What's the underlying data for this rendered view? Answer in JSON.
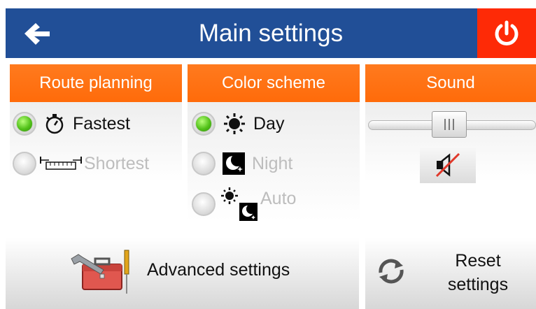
{
  "header": {
    "title": "Main settings"
  },
  "columns": {
    "route": {
      "title": "Route planning",
      "options": [
        {
          "label": "Fastest",
          "selected": true,
          "icon": "stopwatch-icon"
        },
        {
          "label": "Shortest",
          "selected": false,
          "icon": "ruler-icon"
        }
      ]
    },
    "color": {
      "title": "Color scheme",
      "options": [
        {
          "label": "Day",
          "selected": true,
          "icon": "sun-icon"
        },
        {
          "label": "Night",
          "selected": false,
          "icon": "moon-icon"
        },
        {
          "label": "Auto",
          "selected": false,
          "icon": "sun-moon-icon"
        }
      ]
    },
    "sound": {
      "title": "Sound",
      "volume_level": 0.48,
      "muted": true
    }
  },
  "buttons": {
    "advanced": "Advanced settings",
    "reset_line1": "Reset",
    "reset_line2": "settings"
  },
  "colors": {
    "header_bg": "#214f97",
    "accent_orange": "#ff6b0a",
    "power_red": "#fe2a06",
    "radio_green": "#53c21a"
  }
}
